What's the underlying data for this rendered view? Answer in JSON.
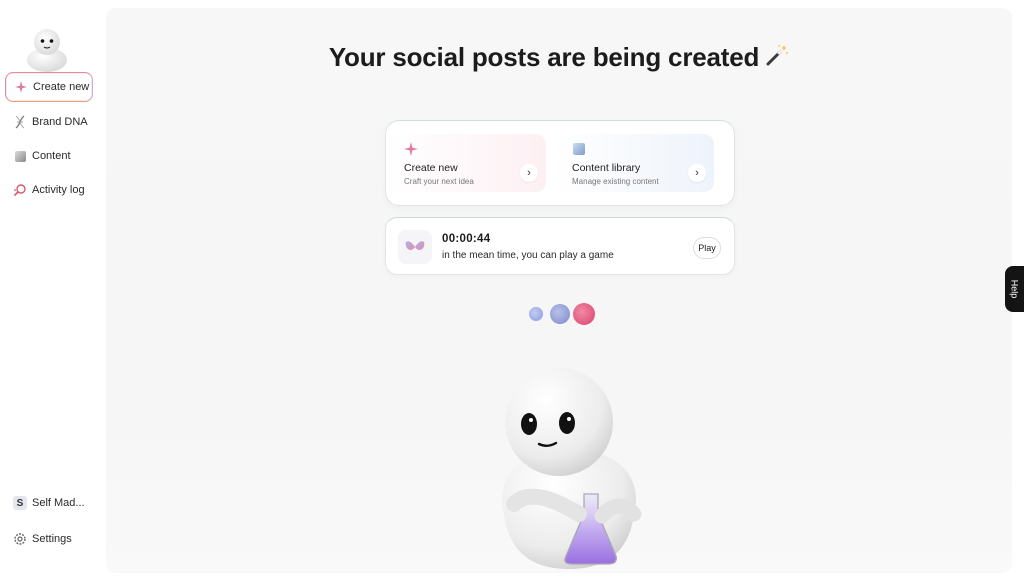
{
  "sidebar": {
    "items": [
      {
        "label": "Create new",
        "icon": "sparkle-icon",
        "active": true
      },
      {
        "label": "Brand DNA",
        "icon": "dna-icon"
      },
      {
        "label": "Content",
        "icon": "content-icon"
      },
      {
        "label": "Activity log",
        "icon": "activity-icon"
      }
    ],
    "account": {
      "initial": "S",
      "label": "Self Mad..."
    },
    "settings": {
      "label": "Settings",
      "icon": "gear-icon"
    }
  },
  "main": {
    "title": "Your social posts are being created",
    "title_emoji": "magic-wand-icon",
    "cards": [
      {
        "title": "Create new",
        "subtitle": "Craft your next idea",
        "icon": "sparkle-icon",
        "arrow": "›"
      },
      {
        "title": "Content library",
        "subtitle": "Manage existing content",
        "icon": "content-icon",
        "arrow": "›"
      }
    ],
    "timer": {
      "time": "00:00:44",
      "message": "in the mean time, you can play a game",
      "play_label": "Play",
      "icon": "butterfly-icon"
    },
    "loading_dots": [
      "#a9b6ea",
      "#9fa8d8",
      "#e4557c"
    ]
  },
  "help": {
    "label": "Help"
  }
}
